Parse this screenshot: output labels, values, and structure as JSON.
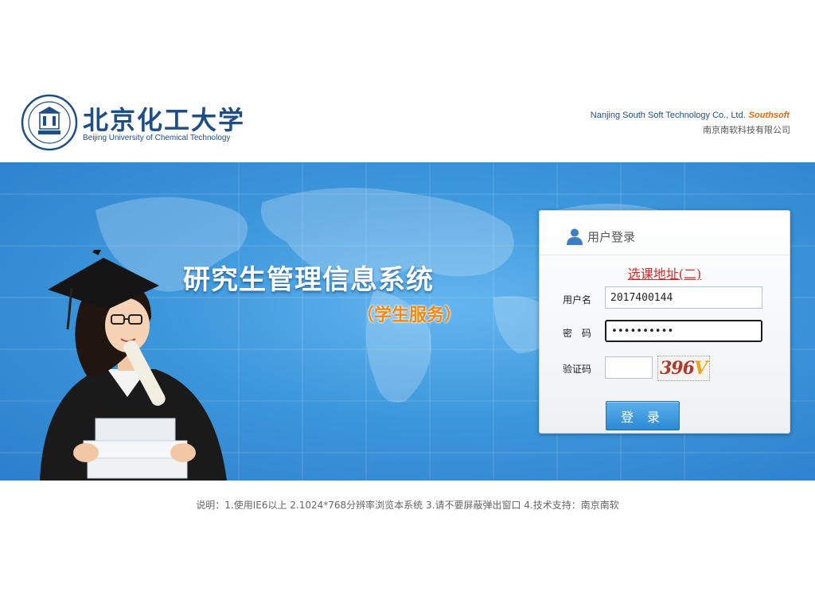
{
  "header": {
    "university_cn": "北京化工大学",
    "university_en": "Beijing University of Chemical Technology",
    "company_en": "Nanjing South Soft Technology Co., Ltd.",
    "company_brand": "Southsoft",
    "company_cn": "南京南软科技有限公司"
  },
  "banner": {
    "system_title": "研究生管理信息系统",
    "system_subtitle": "（学生服务）"
  },
  "login": {
    "title": "用户登录",
    "course_link": "选课地址(二)",
    "username_label": "用户名",
    "username_value": "2017400144",
    "password_label": "密 码",
    "password_value": "••••••••••",
    "captcha_label": "验证码",
    "captcha_value": "",
    "captcha_text": "396",
    "captcha_text_tail": "V",
    "submit_label": "登 录"
  },
  "footer": {
    "note": "说明：1.使用IE6以上  2.1024*768分辨率浏览本系统  3.请不要屏蔽弹出窗口  4.技术支持：南京南软"
  },
  "colors": {
    "banner_blue": "#3d97dc",
    "title_blue": "#1f4d86",
    "subtitle_orange": "#f38a14",
    "link_red": "#d42a2a",
    "brand_orange": "#e86a10"
  },
  "icons": [
    "university-seal",
    "user-icon",
    "graduate-illustration",
    "world-map"
  ]
}
